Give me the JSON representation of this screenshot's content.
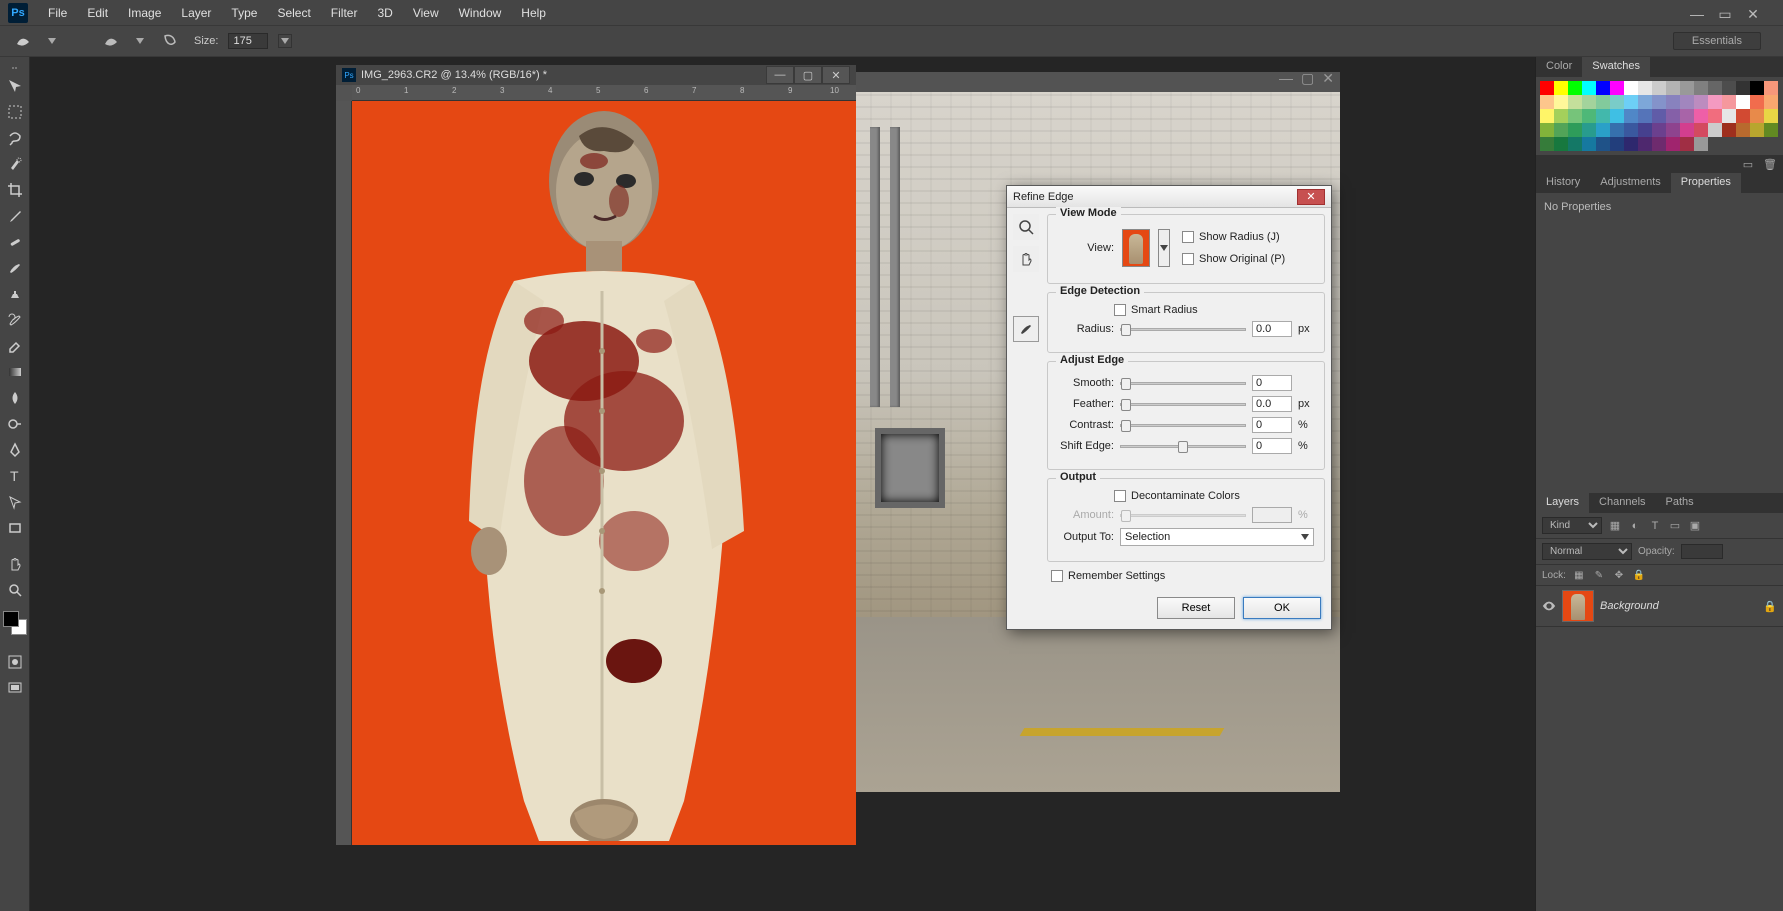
{
  "menubar": {
    "items": [
      "File",
      "Edit",
      "Image",
      "Layer",
      "Type",
      "Select",
      "Filter",
      "3D",
      "View",
      "Window",
      "Help"
    ]
  },
  "optionbar": {
    "size_label": "Size:",
    "size_value": "175",
    "workspace": "Essentials"
  },
  "document1": {
    "title": "IMG_2963.CR2 @ 13.4% (RGB/16*) *"
  },
  "dialog": {
    "title": "Refine Edge",
    "viewmode_legend": "View Mode",
    "view_label": "View:",
    "show_radius": "Show Radius (J)",
    "show_original": "Show Original (P)",
    "edge_legend": "Edge Detection",
    "smart_radius": "Smart Radius",
    "radius_label": "Radius:",
    "radius_value": "0.0",
    "radius_unit": "px",
    "adjust_legend": "Adjust Edge",
    "smooth_label": "Smooth:",
    "smooth_value": "0",
    "feather_label": "Feather:",
    "feather_value": "0.0",
    "feather_unit": "px",
    "contrast_label": "Contrast:",
    "contrast_value": "0",
    "contrast_unit": "%",
    "shift_label": "Shift Edge:",
    "shift_value": "0",
    "shift_unit": "%",
    "output_legend": "Output",
    "decontaminate": "Decontaminate Colors",
    "amount_label": "Amount:",
    "amount_unit": "%",
    "outputto_label": "Output To:",
    "outputto_value": "Selection",
    "remember": "Remember Settings",
    "reset": "Reset",
    "ok": "OK"
  },
  "panels": {
    "color_tab": "Color",
    "swatches_tab": "Swatches",
    "history_tab": "History",
    "adjustments_tab": "Adjustments",
    "properties_tab": "Properties",
    "no_properties": "No Properties",
    "layers_tab": "Layers",
    "channels_tab": "Channels",
    "paths_tab": "Paths",
    "kind_label": "Kind",
    "blend_mode": "Normal",
    "opacity_label": "Opacity:",
    "lock_label": "Lock:",
    "layer_name": "Background"
  },
  "swatch_colors": [
    "#ff0000",
    "#ffff00",
    "#00ff00",
    "#00ffff",
    "#0000ff",
    "#ff00ff",
    "#ffffff",
    "#e6e6e6",
    "#cccccc",
    "#b3b3b3",
    "#999999",
    "#808080",
    "#666666",
    "#4d4d4d",
    "#333333",
    "#000000",
    "#f7977a",
    "#fdc68c",
    "#fff79a",
    "#c4df9b",
    "#a3d39c",
    "#82ca9c",
    "#7accc8",
    "#6dcff6",
    "#7da7d9",
    "#8493ca",
    "#8882be",
    "#a186be",
    "#bc8cbf",
    "#f49ac1",
    "#f5989d",
    "#ffffff",
    "#f16c4d",
    "#f9a76f",
    "#fff568",
    "#a4d05b",
    "#76c47a",
    "#4eb878",
    "#42b8ac",
    "#3fbfe4",
    "#5087c7",
    "#5574b9",
    "#605ca8",
    "#8560a8",
    "#a864a8",
    "#ee5fa7",
    "#f16d7e",
    "#e6e6e6",
    "#d24a32",
    "#e88a4a",
    "#e8d645",
    "#82b33a",
    "#52a458",
    "#2e9c5a",
    "#289c8e",
    "#2aa0c8",
    "#3670ad",
    "#3a589f",
    "#46408e",
    "#6b408e",
    "#8e438e",
    "#d33e8e",
    "#d34a60",
    "#cccccc",
    "#9e2f1d",
    "#b86a2e",
    "#b8a62e",
    "#628a22",
    "#367c3a",
    "#17783e",
    "#147866",
    "#1679a0",
    "#1f5288",
    "#223e7c",
    "#2e286e",
    "#4e286e",
    "#6e2b6e",
    "#a0246e",
    "#a02e44",
    "#999999"
  ]
}
